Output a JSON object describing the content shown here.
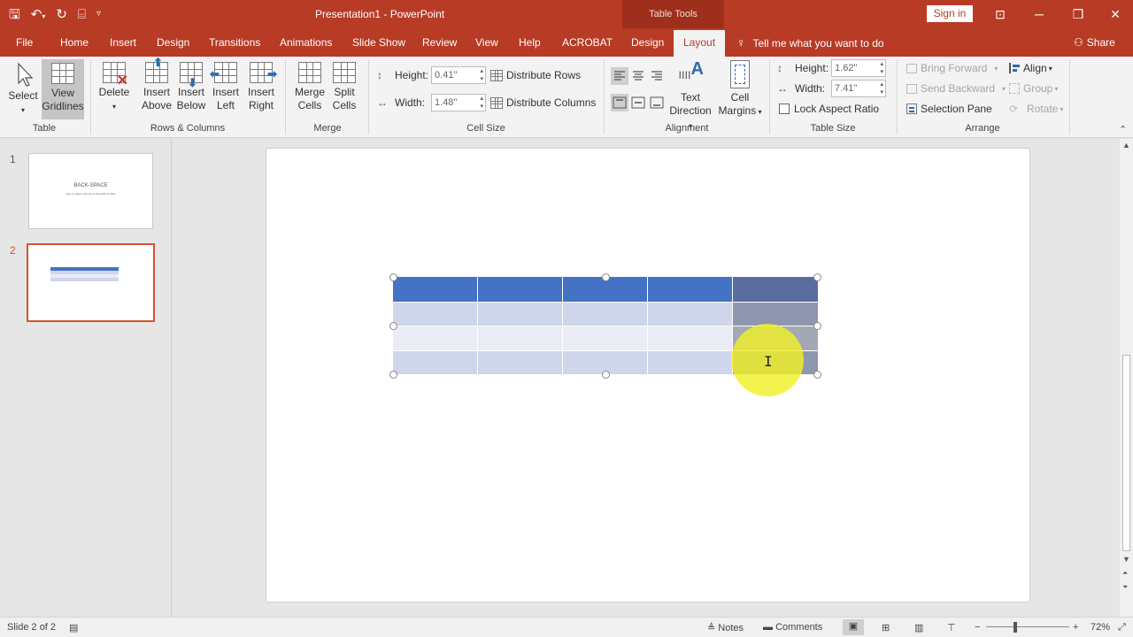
{
  "titlebar": {
    "doc_title": "Presentation1 - PowerPoint",
    "context_tab": "Table Tools",
    "sign_in": "Sign in",
    "qat_icons": [
      "save-icon",
      "undo-icon",
      "redo-icon",
      "present-icon",
      "customize-icon"
    ]
  },
  "tabs": [
    "File",
    "Home",
    "Insert",
    "Design",
    "Transitions",
    "Animations",
    "Slide Show",
    "Review",
    "View",
    "Help",
    "ACROBAT",
    "Design",
    "Layout"
  ],
  "tell_me": "Tell me what you want to do",
  "share": "Share",
  "ribbon": {
    "table": {
      "select": "Select",
      "view_gridlines_1": "View",
      "view_gridlines_2": "Gridlines",
      "group": "Table"
    },
    "rows_columns": {
      "delete": "Delete",
      "insert_above_1": "Insert",
      "insert_above_2": "Above",
      "insert_below_1": "Insert",
      "insert_below_2": "Below",
      "insert_left_1": "Insert",
      "insert_left_2": "Left",
      "insert_right_1": "Insert",
      "insert_right_2": "Right",
      "group": "Rows & Columns"
    },
    "merge": {
      "merge_1": "Merge",
      "merge_2": "Cells",
      "split_1": "Split",
      "split_2": "Cells",
      "group": "Merge"
    },
    "cell_size": {
      "height_label": "Height:",
      "height_value": "0.41\"",
      "width_label": "Width:",
      "width_value": "1.48\"",
      "distribute_rows": "Distribute Rows",
      "distribute_columns": "Distribute Columns",
      "group": "Cell Size"
    },
    "alignment": {
      "text_direction_1": "Text",
      "text_direction_2": "Direction",
      "cell_margins_1": "Cell",
      "cell_margins_2": "Margins",
      "group": "Alignment"
    },
    "table_size": {
      "height_label": "Height:",
      "height_value": "1.62\"",
      "width_label": "Width:",
      "width_value": "7.41\"",
      "lock_aspect": "Lock Aspect Ratio",
      "group": "Table Size"
    },
    "arrange": {
      "bring_forward": "Bring Forward",
      "send_backward": "Send Backward",
      "selection_pane": "Selection Pane",
      "align": "Align",
      "group_btn": "Group",
      "rotate": "Rotate",
      "group": "Arrange"
    }
  },
  "slides": [
    {
      "number": "1",
      "title": "BACK-SPACE",
      "subtitle": "How to share columns in PowerPoint table"
    },
    {
      "number": "2"
    }
  ],
  "status": {
    "slide": "Slide 2 of 2",
    "notes": "Notes",
    "comments": "Comments",
    "zoom": "72%"
  },
  "colors": {
    "accent": "#b83b26",
    "header_blue": "#4472c4",
    "row_band": "#cfd5ea",
    "row_alt": "#e9ebf5",
    "selected_col": "#8e97ad"
  }
}
